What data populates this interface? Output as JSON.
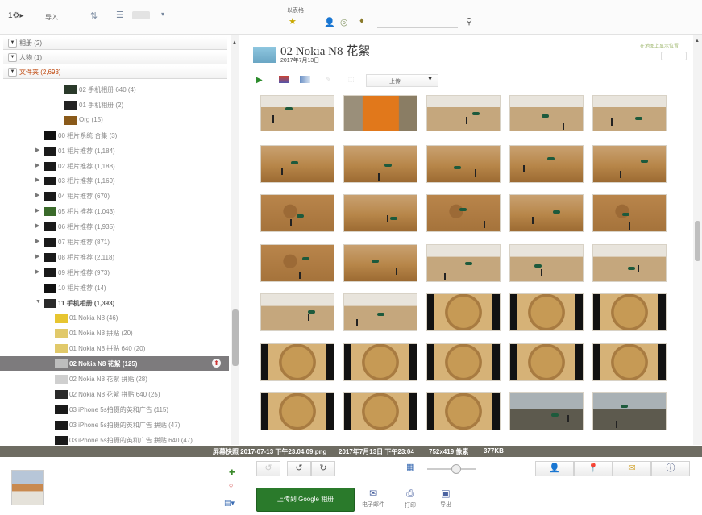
{
  "toolbar": {
    "import_label": "导入",
    "search_label": "以表格",
    "search_placeholder": ""
  },
  "sidebar": {
    "sections": [
      {
        "label": "相册 (2)"
      },
      {
        "label": "人物 (1)"
      },
      {
        "label": "文件夹 (2,693)"
      }
    ],
    "items": [
      {
        "label": "02 手机相册 640 (4)",
        "expandable": false
      },
      {
        "label": "01 手机相册 (2)",
        "expandable": false
      },
      {
        "label": "Org (15)",
        "expandable": false
      },
      {
        "label": "00 相片系统 合集 (3)",
        "expandable": false
      },
      {
        "label": "01 相片推荐 (1,184)",
        "expandable": true
      },
      {
        "label": "02 相片推荐 (1,188)",
        "expandable": true
      },
      {
        "label": "03 相片推荐 (1,169)",
        "expandable": true
      },
      {
        "label": "04 相片推荐 (670)",
        "expandable": true
      },
      {
        "label": "05 相片推荐 (1,043)",
        "expandable": true
      },
      {
        "label": "06 相片推荐 (1,935)",
        "expandable": true
      },
      {
        "label": "07 相片推荐 (871)",
        "expandable": true
      },
      {
        "label": "08 相片推荐 (2,118)",
        "expandable": true
      },
      {
        "label": "09 相片推荐 (973)",
        "expandable": true
      },
      {
        "label": "10 相片推荐 (14)",
        "expandable": false
      },
      {
        "label": "11 手机相册 (1,393)",
        "expandable": true
      },
      {
        "label": "01 Nokia N8 (46)",
        "expandable": false
      },
      {
        "label": "01 Nokia N8 拼贴 (20)",
        "expandable": false
      },
      {
        "label": "01 Nokia N8 拼贴 640 (20)",
        "expandable": false
      },
      {
        "label": "02 Nokia N8 花絮 (125)",
        "expandable": false
      },
      {
        "label": "02 Nokia N8 花絮 拼贴 (28)",
        "expandable": false
      },
      {
        "label": "02 Nokia N8 花絮 拼贴 640 (25)",
        "expandable": false
      },
      {
        "label": "03 iPhone 5s拍摄的英和广告 (115)",
        "expandable": false
      },
      {
        "label": "03 iPhone 5s拍摄的英和广告 拼贴 (47)",
        "expandable": false
      },
      {
        "label": "03 iPhone 5s拍摄的英和广告 拼贴 640 (47)",
        "expandable": false
      }
    ]
  },
  "main": {
    "album_title": "02 Nokia N8 花絮",
    "album_date": "2017年7月13日",
    "upload_dropdown": "上传",
    "right_link": "在地图上显示位置"
  },
  "status": {
    "filename": "屏幕快照 2017-07-13 下午23.04.09.png",
    "date": "2017年7月13日 下午23:04",
    "dimensions": "752x419 像素",
    "size": "377KB"
  },
  "bottom": {
    "upload_button": "上传到 Google 相册",
    "email_label": "电子邮件",
    "print_label": "打印",
    "export_label": "导出"
  },
  "colors": {
    "selected_row": "#7d7b7d",
    "upload_green": "#2a7a2b",
    "status_bar": "#6e6c62"
  }
}
